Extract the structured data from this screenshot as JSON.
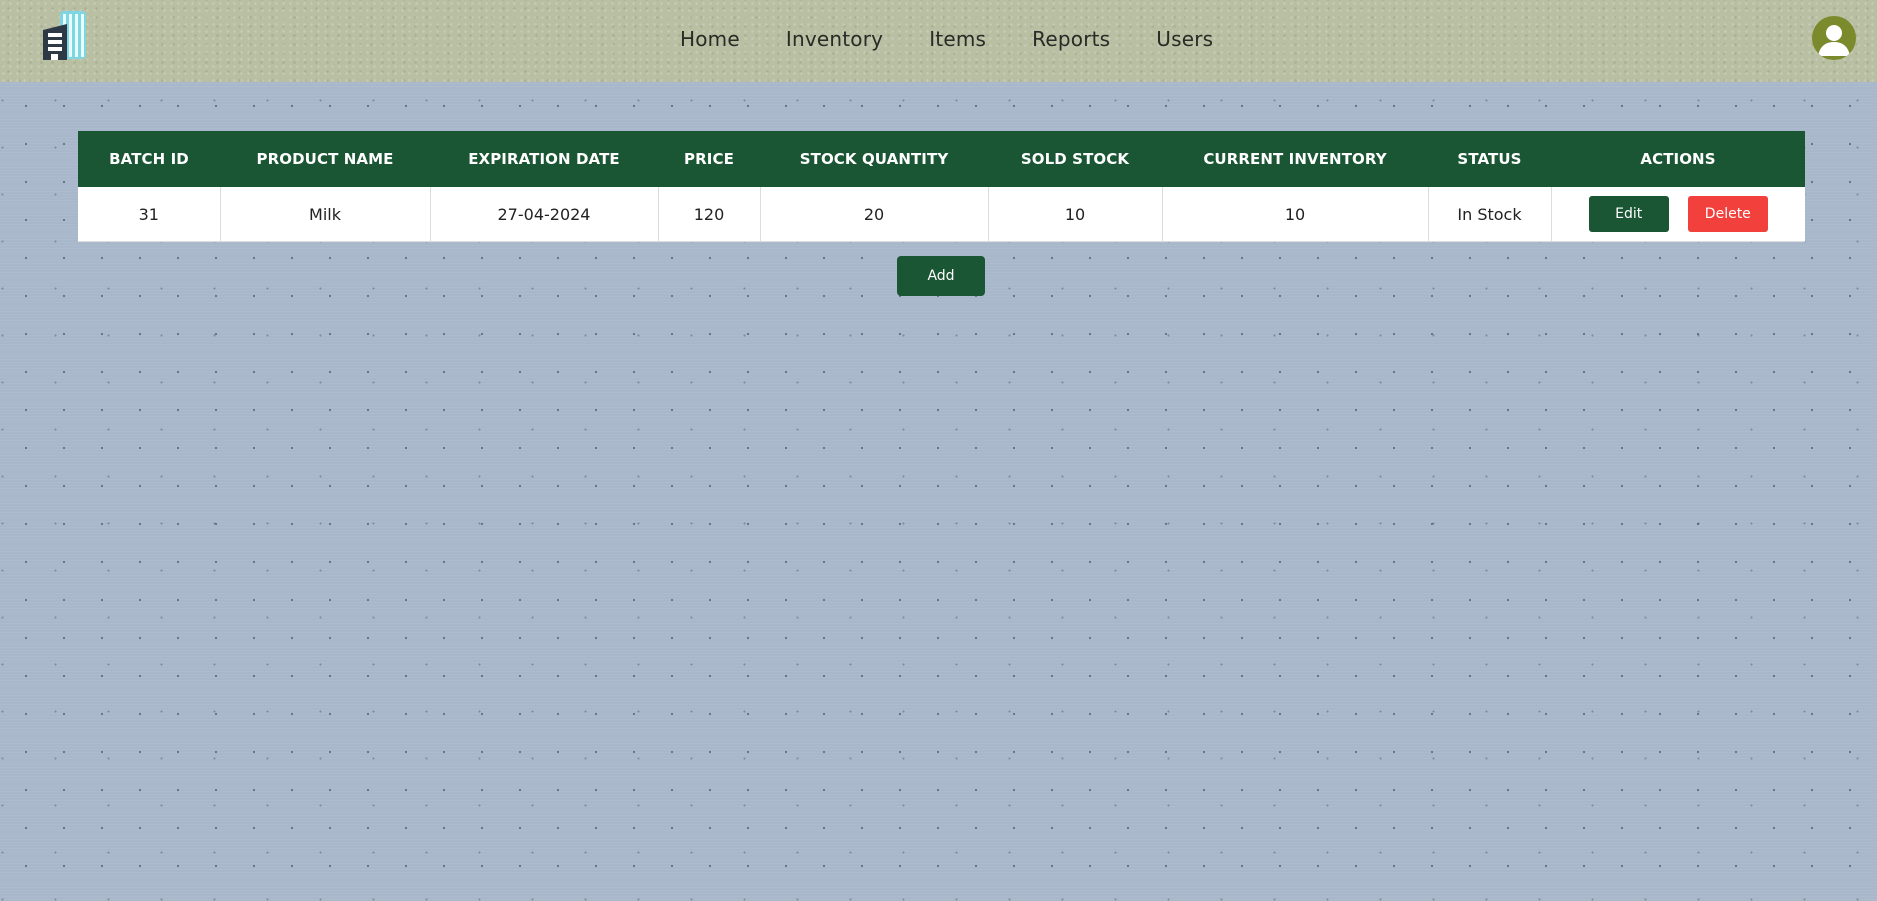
{
  "nav": {
    "items": [
      "Home",
      "Inventory",
      "Items",
      "Reports",
      "Users"
    ]
  },
  "table": {
    "columns": [
      "BATCH ID",
      "PRODUCT NAME",
      "EXPIRATION DATE",
      "PRICE",
      "STOCK QUANTITY",
      "SOLD STOCK",
      "CURRENT INVENTORY",
      "STATUS",
      "ACTIONS"
    ],
    "rows": [
      {
        "batch_id": "31",
        "product_name": "Milk",
        "expiration_date": "27-04-2024",
        "price": "120",
        "stock_quantity": "20",
        "sold_stock": "10",
        "current_inventory": "10",
        "status": "In Stock"
      }
    ],
    "edit_label": "Edit",
    "delete_label": "Delete"
  },
  "add_label": "Add",
  "icons": {
    "logo": "building-logo-icon",
    "avatar": "user-avatar-icon"
  },
  "colors": {
    "primary": "#1a5633",
    "danger": "#f2413d",
    "header_bg": "#b9bfa2",
    "page_bg": "#a9b7cb"
  }
}
